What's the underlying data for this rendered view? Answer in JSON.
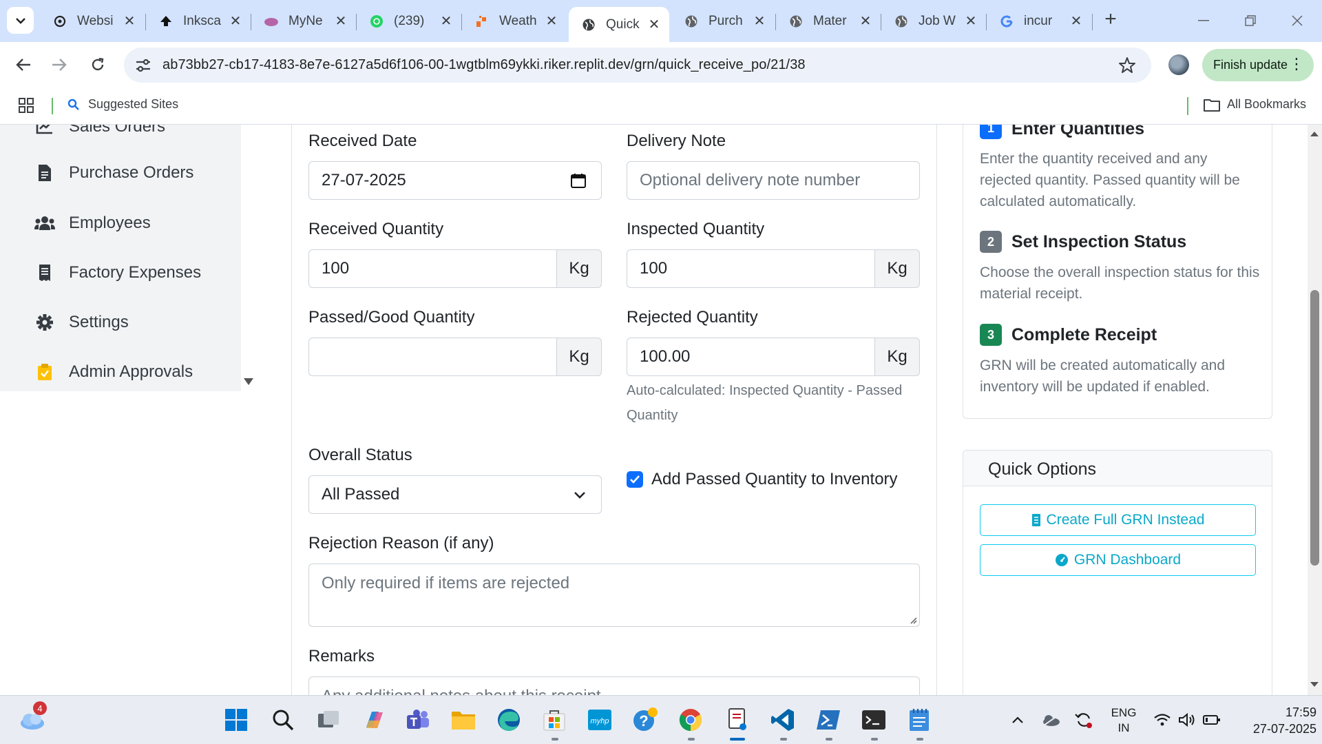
{
  "browser": {
    "tabs": [
      {
        "title": "Websi",
        "icon": "openai-icon"
      },
      {
        "title": "Inksca",
        "icon": "inkscape-icon"
      },
      {
        "title": "MyNe",
        "icon": "mynet-icon"
      },
      {
        "title": "(239)",
        "icon": "whatsapp-icon"
      },
      {
        "title": "Weath",
        "icon": "weather-icon"
      },
      {
        "title": "Quick",
        "icon": "globe-icon",
        "active": true
      },
      {
        "title": "Purch",
        "icon": "globe-icon"
      },
      {
        "title": "Mater",
        "icon": "globe-icon"
      },
      {
        "title": "Job W",
        "icon": "globe-icon"
      },
      {
        "title": "incur",
        "icon": "google-icon"
      }
    ],
    "url": "ab73bb27-cb17-4183-8e7e-6127a5d6f106-00-1wgtblm69ykki.riker.replit.dev/grn/quick_receive_po/21/38",
    "finish_update_label": "Finish update",
    "bookmarks": {
      "suggested": "Suggested Sites",
      "all": "All Bookmarks"
    }
  },
  "sidebar": {
    "items": [
      {
        "label": "Sales Orders",
        "icon": "chart-icon"
      },
      {
        "label": "Purchase Orders",
        "icon": "document-icon"
      },
      {
        "label": "Employees",
        "icon": "users-icon"
      },
      {
        "label": "Factory Expenses",
        "icon": "receipt-icon"
      },
      {
        "label": "Settings",
        "icon": "gear-icon"
      },
      {
        "label": "Admin Approvals",
        "icon": "clipboard-check-icon"
      }
    ]
  },
  "form": {
    "received_date": {
      "label": "Received Date",
      "value": "27-07-2025"
    },
    "delivery_note": {
      "label": "Delivery Note",
      "placeholder": "Optional delivery note number"
    },
    "received_qty": {
      "label": "Received Quantity",
      "value": "100",
      "unit": "Kg"
    },
    "inspected_qty": {
      "label": "Inspected Quantity",
      "value": "100",
      "unit": "Kg"
    },
    "passed_qty": {
      "label": "Passed/Good Quantity",
      "value": "",
      "unit": "Kg"
    },
    "rejected_qty": {
      "label": "Rejected Quantity",
      "value": "100.00",
      "unit": "Kg",
      "help": "Auto-calculated: Inspected Quantity - Passed Quantity"
    },
    "overall_status": {
      "label": "Overall Status",
      "value": "All Passed"
    },
    "add_inventory": {
      "label": "Add Passed Quantity to Inventory",
      "checked": true
    },
    "rejection_reason": {
      "label": "Rejection Reason (if any)",
      "placeholder": "Only required if items are rejected"
    },
    "remarks": {
      "label": "Remarks",
      "placeholder": "Any additional notes about this receipt"
    }
  },
  "steps": [
    {
      "num": "1",
      "title": "Enter Quantities",
      "text": "Enter the quantity received and any rejected quantity. Passed quantity will be calculated automatically.",
      "color": "#0d6efd"
    },
    {
      "num": "2",
      "title": "Set Inspection Status",
      "text": "Choose the overall inspection status for this material receipt.",
      "color": "#6c757d"
    },
    {
      "num": "3",
      "title": "Complete Receipt",
      "text": "GRN will be created automatically and inventory will be updated if enabled.",
      "color": "#198754"
    }
  ],
  "quick_options": {
    "title": "Quick Options",
    "create_full": "Create Full GRN Instead",
    "dashboard": "GRN Dashboard"
  },
  "taskbar": {
    "weather_badge": "4",
    "lang": "ENG",
    "region": "IN",
    "time": "17:59",
    "date": "27-07-2025"
  },
  "colors": {
    "primary": "#0d6efd",
    "info": "#0dcaf0",
    "success": "#198754",
    "chrome_tabstrip": "#d3e3fd"
  }
}
